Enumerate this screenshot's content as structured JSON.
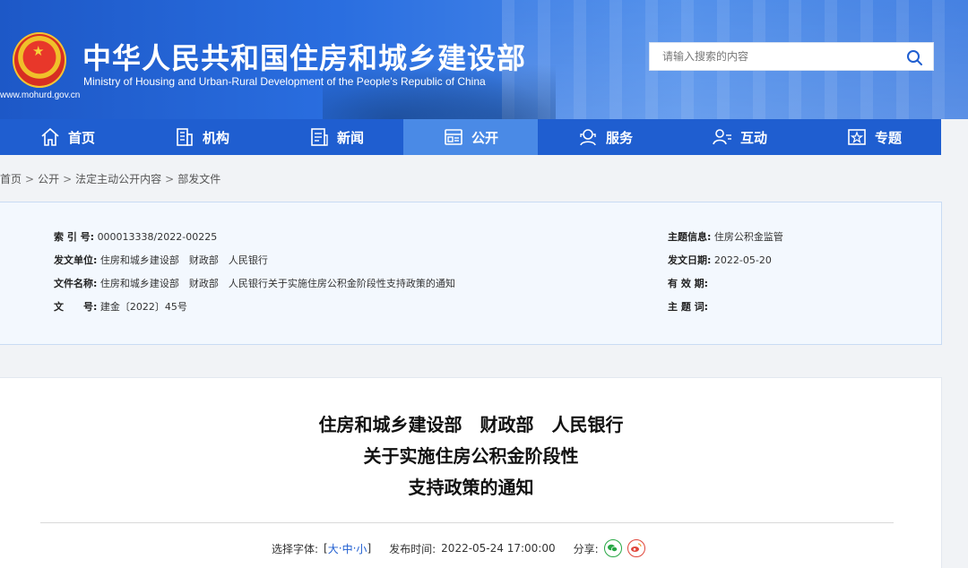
{
  "header": {
    "site_title": "中华人民共和国住房和城乡建设部",
    "site_subtitle": "Ministry of Housing and Urban-Rural Development of the People’s Republic of China",
    "site_url": "www.mohurd.gov.cn",
    "search_placeholder": "请输入搜索的内容"
  },
  "nav": {
    "items": [
      {
        "label": "首页",
        "icon": "home-icon"
      },
      {
        "label": "机构",
        "icon": "building-icon"
      },
      {
        "label": "新闻",
        "icon": "news-icon"
      },
      {
        "label": "公开",
        "icon": "document-icon"
      },
      {
        "label": "服务",
        "icon": "service-icon"
      },
      {
        "label": "互动",
        "icon": "interaction-icon"
      },
      {
        "label": "专题",
        "icon": "topic-icon"
      }
    ],
    "active": "公开"
  },
  "breadcrumb": [
    "首页",
    "公开",
    "法定主动公开内容",
    "部发文件"
  ],
  "meta": {
    "index_label": "索 引 号:",
    "index_value": "000013338/2022-00225",
    "issuer_label": "发文单位:",
    "issuer_value": "住房和城乡建设部　财政部　人民银行",
    "docname_label": "文件名称:",
    "docname_value": "住房和城乡建设部　财政部　人民银行关于实施住房公积金阶段性支持政策的通知",
    "docno_label": "文　　号:",
    "docno_value": "建金〔2022〕45号",
    "topic_label": "主题信息:",
    "topic_value": "住房公积金监管",
    "date_label": "发文日期:",
    "date_value": "2022-05-20",
    "validity_label": "有 效 期:",
    "validity_value": "",
    "subject_label": "主 题 词:",
    "subject_value": ""
  },
  "article": {
    "title_line1": "住房和城乡建设部　财政部　人民银行",
    "title_line2": "关于实施住房公积金阶段性",
    "title_line3": "支持政策的通知",
    "font_select_label": "选择字体:",
    "font_open": "[",
    "font_large": "大",
    "font_dash1": "·",
    "font_medium": "中",
    "font_dash2": "·",
    "font_small": "小",
    "font_close": "]",
    "publish_label": "发布时间:",
    "publish_time": "2022-05-24 17:00:00",
    "share_label": "分享:"
  },
  "colors": {
    "brand_blue": "#1f5ed0",
    "nav_active": "#4a8ae6",
    "meta_bg": "#f3f8fe"
  }
}
